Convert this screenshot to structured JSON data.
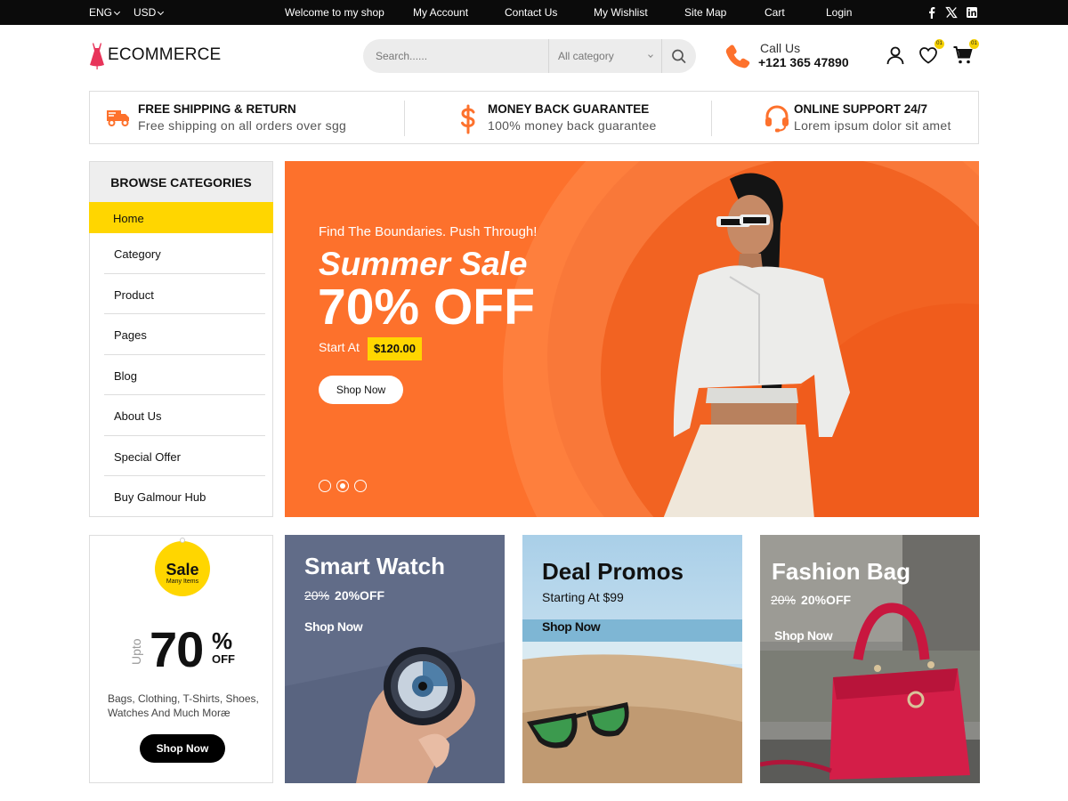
{
  "topbar": {
    "lang": "ENG",
    "currency": "USD",
    "links": [
      "Welcome to my shop",
      "My Account",
      "Contact Us",
      "My Wishlist",
      "Site Map",
      "Cart",
      "Login"
    ],
    "social": [
      "facebook-icon",
      "x-icon",
      "linkedin-icon"
    ]
  },
  "header": {
    "logo": "ECOMMERCE",
    "search_placeholder": "Search......",
    "category": "All category",
    "call_label": "Call Us",
    "phone": "+121 365 47890",
    "wishlist_count": "01",
    "cart_count": "01"
  },
  "features": [
    {
      "title": "FREE SHIPPING & RETURN",
      "text": "Free shipping on all orders over sgg",
      "icon": "truck-icon"
    },
    {
      "title": "MONEY BACK GUARANTEE",
      "text": "100% money back guarantee",
      "icon": "dollar-icon"
    },
    {
      "title": "ONLINE SUPPORT 24/7",
      "text": "Lorem ipsum dolor sit amet",
      "icon": "headset-icon"
    }
  ],
  "sidebar": {
    "heading": "BROWSE CATEGORIES",
    "items": [
      "Home",
      "Category",
      "Product",
      "Pages",
      "Blog",
      "About Us",
      "Special Offer",
      "Buy Galmour Hub"
    ]
  },
  "banner": {
    "subtitle": "Find The Boundaries. Push Through!",
    "title": "Summer Sale",
    "discount": "70% OFF",
    "start_label": "Start At",
    "price": "$120.00",
    "button": "Shop Now"
  },
  "sale_box": {
    "tag_title": "Sale",
    "tag_sub": "Many Items",
    "upto": "Upto",
    "number": "70",
    "percent": "%",
    "off": "OFF",
    "description": "Bags, Clothing, T-Shirts, Shoes, Watches And Much Moræ",
    "button": "Shop Now"
  },
  "cards": [
    {
      "title": "Smart Watch",
      "old": "20%",
      "offer": "20%OFF",
      "button": "Shop Now"
    },
    {
      "title": "Deal Promos",
      "offer": "Starting At $99",
      "button": "Shop Now"
    },
    {
      "title": "Fashion Bag",
      "old": "20%",
      "offer": "20%OFF",
      "button": "Shop Now"
    }
  ],
  "colors": {
    "accent": "#fd712c",
    "highlight": "#ffd600",
    "dark": "#0b0b0b"
  }
}
